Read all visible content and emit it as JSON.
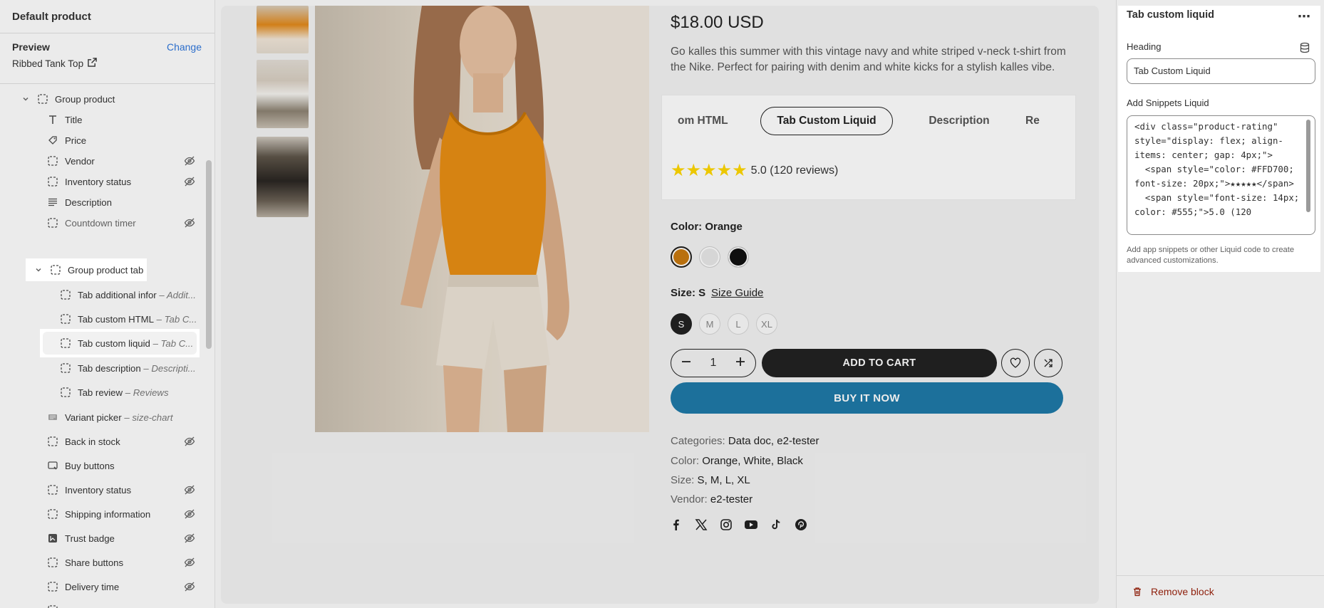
{
  "sidebar": {
    "header": "Default product",
    "preview_label": "Preview",
    "change_link": "Change",
    "preview_product": "Ribbed Tank Top",
    "tree": {
      "group_product": "Group product",
      "title": "Title",
      "price": "Price",
      "vendor": "Vendor",
      "inventory_status": "Inventory status",
      "description": "Description",
      "countdown_timer": "Countdown timer",
      "group_product_tab": "Group product tab",
      "tab_additional": "Tab additional infor",
      "tab_additional_sub": "– Addit...",
      "tab_custom_html": "Tab custom HTML",
      "tab_custom_html_sub": "– Tab C...",
      "tab_custom_liquid": "Tab custom liquid",
      "tab_custom_liquid_sub": "– Tab C...",
      "tab_description": "Tab description",
      "tab_description_sub": "– Descripti...",
      "tab_review": "Tab review",
      "tab_review_sub": "– Reviews",
      "variant_picker": "Variant picker",
      "variant_picker_sub": "– size-chart",
      "back_in_stock": "Back in stock",
      "buy_buttons": "Buy buttons",
      "inventory_status_2": "Inventory status",
      "shipping_information": "Shipping information",
      "trust_badge": "Trust badge",
      "share_buttons": "Share buttons",
      "delivery_time": "Delivery time"
    }
  },
  "product": {
    "price": "$18.00 USD",
    "description": "Go kalles this summer with this vintage navy and white striped v-neck t-shirt from the Nike. Perfect for pairing with denim and white kicks for a stylish kalles vibe.",
    "tabs": {
      "tab_html": "om HTML",
      "tab_liquid": "Tab Custom Liquid",
      "tab_description": "Description",
      "tab_review": "Re"
    },
    "rating_stars": "★★★★★",
    "rating_text": "5.0 (120 reviews)",
    "color_label": "Color: Orange",
    "swatches": [
      "#c87a10",
      "#e8e8e8",
      "#111111"
    ],
    "size_label": "Size: S",
    "size_guide": "Size Guide",
    "sizes": [
      "S",
      "M",
      "L",
      "XL"
    ],
    "quantity": "1",
    "add_to_cart": "ADD TO CART",
    "buy_it_now": "BUY IT NOW",
    "categories_label": "Categories:",
    "categories_value": "Data doc, e2-tester",
    "color_meta_label": "Color:",
    "color_meta_value": "Orange, White, Black",
    "size_meta_label": "Size:",
    "size_meta_value": "S, M, L, XL",
    "vendor_label": "Vendor:",
    "vendor_value": "e2-tester",
    "social_icons": [
      "facebook-icon",
      "x-icon",
      "instagram-icon",
      "youtube-icon",
      "tiktok-icon",
      "pinterest-icon"
    ]
  },
  "panel": {
    "title": "Tab custom liquid",
    "heading_label": "Heading",
    "heading_value": "Tab Custom Liquid",
    "snippet_label": "Add Snippets Liquid",
    "snippet_code": "<div class=\"product-rating\" style=\"display: flex; align-items: center; gap: 4px;\">\n  <span style=\"color: #FFD700; font-size: 20px;\">★★★★★</span>\n  <span style=\"font-size: 14px; color: #555;\">5.0 (120",
    "help_text": "Add app snippets or other Liquid code to create advanced customizations.",
    "remove_block": "Remove block"
  },
  "colors": {
    "accent_link": "#2c6ecb",
    "buy_now": "#1f7aa8",
    "star": "#FFD700",
    "remove": "#8e1f0b"
  }
}
